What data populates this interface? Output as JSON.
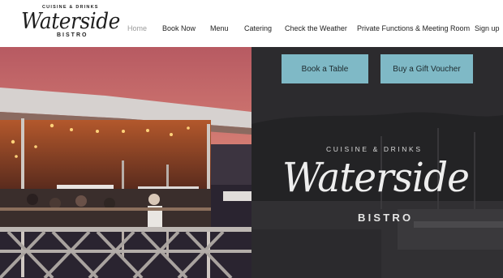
{
  "header": {
    "logo": {
      "top_text": "CUISINE & DRINKS",
      "script_text": "Waterside",
      "bottom_text": "BISTRO"
    },
    "nav": [
      {
        "label": "Home",
        "active": true
      },
      {
        "label": "Book Now",
        "active": false
      },
      {
        "label": "Menu",
        "active": false
      },
      {
        "label": "Catering",
        "active": false
      },
      {
        "label": "Check the Weather",
        "active": false
      },
      {
        "label": "Private Functions & Meeting Room",
        "active": false
      },
      {
        "label": "Sign up",
        "active": false
      }
    ]
  },
  "hero": {
    "buttons": {
      "book_label": "Book a Table",
      "voucher_label": "Buy a Gift Voucher"
    },
    "brand": {
      "top_text": "CUISINE & DRINKS",
      "script_text": "Waterside",
      "bottom_text": "BISTRO"
    }
  },
  "colors": {
    "accent_button": "#7fb9c6",
    "nav_active": "#9a9a9a",
    "nav_text": "#222222",
    "hero_overlay": "#2a2a2c"
  }
}
